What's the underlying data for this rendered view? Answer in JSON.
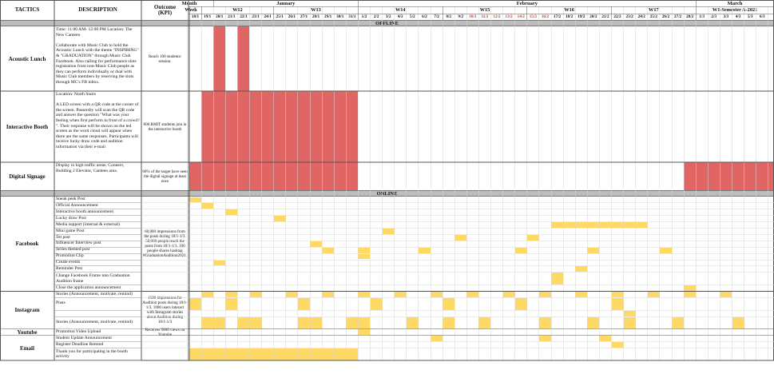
{
  "header": {
    "tactics_label": "TACTICS",
    "description_label": "DESCRIPTION",
    "outcome_label": "Outcome",
    "kpi_label": "(KPI)",
    "month_label": "Month",
    "week_label": "Week"
  },
  "months": [
    "January",
    "February",
    "March"
  ],
  "weeks": [
    "W12",
    "W13",
    "W14",
    "W15",
    "W16",
    "W17",
    "W1-Semester A-2021"
  ],
  "dates": [
    "18/1",
    "19/1",
    "20/1",
    "21/1",
    "22/1",
    "23/1",
    "24/1",
    "25/1",
    "26/1",
    "27/1",
    "28/1",
    "29/1",
    "30/1",
    "31/1",
    "1/2",
    "2/2",
    "3/2",
    "4/2",
    "5/2",
    "6/2",
    "7/2",
    "8/2",
    "9/2",
    "10/2",
    "11/2",
    "12/2",
    "13/2",
    "14/2",
    "15/2",
    "16/2",
    "17/2",
    "18/2",
    "19/2",
    "20/2",
    "21/2",
    "22/2",
    "23/2",
    "24/2",
    "25/2",
    "26/2",
    "27/2",
    "28/2",
    "1/3",
    "2/3",
    "3/3",
    "4/3",
    "5/3",
    "6/3"
  ],
  "red_date_indexes": [
    23,
    24,
    25,
    26,
    27,
    28,
    29
  ],
  "sections": {
    "offline": "OFFLINE",
    "online": "ONLINE"
  },
  "offline": [
    {
      "tactic": "Acoustic Lunch",
      "description": "Time: 11:00 AM- 12:00 PM Location: The New Canteen\n\nCollaborate with Music Club to hold the Acoustic Lunch with the theme \"INSPIRING\" & \"GRADUATION\" through Music Club Facebook. Also calling for performance slots registration from non-Music Club people as they can perform individually or dual with Music Club members by reserving the slots through MC's FB inbox.",
      "kpi": "Reach 100 students/ session."
    },
    {
      "tactic": "Interactive Booth",
      "description": "Location: North Stairs\n\nA LED screen with a QR code at the corner of the screen. Passersby will scan the QR code and answer the question \"What was your feeling when first perform in front of a crowd? \". Their response will be shown on the led screen as the word cloud will appear when there are the same responses. Participants will receive lucky draw code and audition information via their e-mail",
      "kpi": "800 RMIT students join in the interactive booth"
    },
    {
      "tactic": "Digital Signage",
      "description": "Display in high traffic areas: Connect, Building 2 Elevator, Canteen area.",
      "kpi": "60% of the target have seen the digital signage at least once"
    }
  ],
  "online": {
    "facebook": {
      "tactic": "Facebook",
      "kpi": "60,000 impressions from the posts during 18/1-1/3. 50,000 people reach the posts from 18/1-1/3. 100 people shares hashtag #GraduationAudition2021.",
      "rows": [
        "Sneak peek Post",
        "Official Announcement",
        "Interactive booth announcement",
        "Lucky draw Post",
        "Media support (internal & external)",
        "Mini game Post",
        "Tet post",
        "Influencer Interview post",
        "Series themed post",
        "Promotion Clip",
        "Create events",
        "Reminder Post",
        "Change Facebook Frame into Graduation Audition frame",
        "Close the application announcement"
      ]
    },
    "instagram": {
      "tactic": "Instagram",
      "kpi": "1500 impressions for Audition posts during 18/1-1/3. 1000 users interact with Instagram stories about Audition during 18/1-1/3",
      "rows": [
        "Stories (Announcement, motivate, remind)",
        "Posts",
        "",
        "Stories (Announcement, motivate, remind)"
      ]
    },
    "youtube": {
      "tactic": "Youtube",
      "kpi": "Receives 5000 views on Youtube",
      "rows": [
        "Promotion Video Upload"
      ]
    },
    "email": {
      "tactic": "Email",
      "rows": [
        "Student Update Announcement",
        "Register Deadline Remind",
        "Thank you for participating in the booth activity"
      ]
    }
  },
  "colors": {
    "offline_bar": "#e06666",
    "online_bar": "#ffd966",
    "section_band": "#bdbdbd",
    "red_date_text": "#c0392b"
  }
}
